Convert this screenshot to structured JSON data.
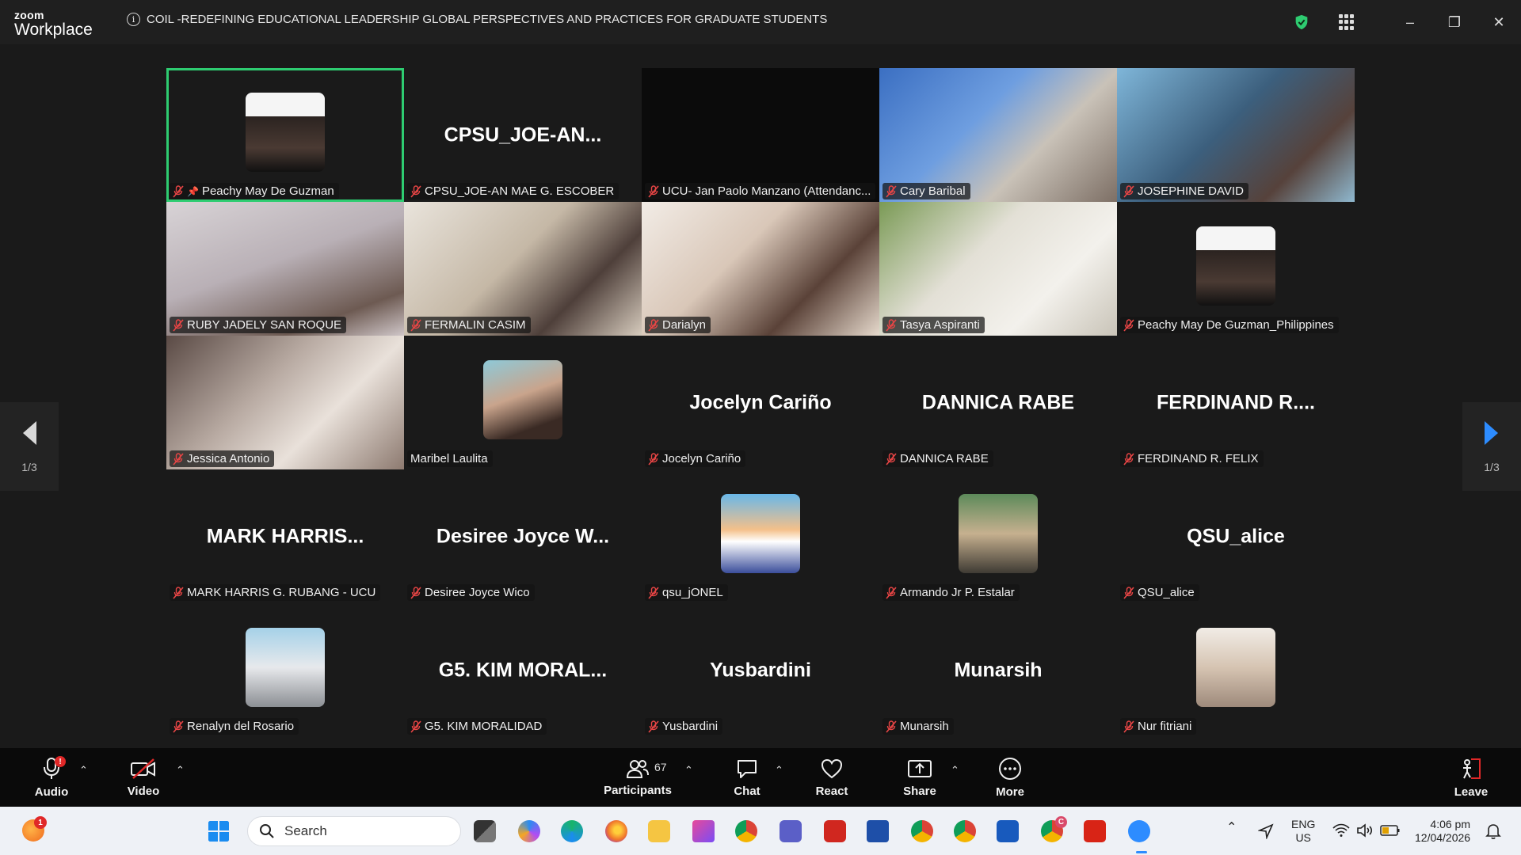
{
  "app": {
    "logo_top": "zoom",
    "logo_bottom": "Workplace",
    "meeting_title": "COIL -REDEFINING EDUCATIONAL LEADERSHIP GLOBAL PERSPECTIVES AND PRACTICES FOR GRADUATE STUDENTS",
    "security_color": "#2ecc71"
  },
  "window_controls": {
    "minimize": "–",
    "restore": "❐",
    "close": "✕"
  },
  "gallery": {
    "page_left": "1/3",
    "page_right": "1/3",
    "tiles": [
      {
        "label": "Peachy May De Guzman",
        "display": "photo",
        "pinned": true,
        "active": true
      },
      {
        "label": "CPSU_JOE-AN MAE G. ESCOBER",
        "display": "name",
        "big": "CPSU_JOE-AN..."
      },
      {
        "label": "UCU- Jan Paolo Manzano (Attendanc...",
        "display": "black"
      },
      {
        "label": "Cary Baribal",
        "display": "video"
      },
      {
        "label": "JOSEPHINE DAVID",
        "display": "video"
      },
      {
        "label": "RUBY JADELY SAN ROQUE",
        "display": "video"
      },
      {
        "label": "FERMALIN CASIM",
        "display": "video"
      },
      {
        "label": "Darialyn",
        "display": "video"
      },
      {
        "label": "Tasya Aspiranti",
        "display": "video"
      },
      {
        "label": "Peachy May De Guzman_Philippines",
        "display": "photo"
      },
      {
        "label": "Jessica Antonio",
        "display": "video"
      },
      {
        "label": "Maribel Laulita",
        "display": "photo",
        "unmuted": true
      },
      {
        "label": "Jocelyn Cariño",
        "display": "name",
        "big": "Jocelyn Cariño"
      },
      {
        "label": "DANNICA RABE",
        "display": "name",
        "big": "DANNICA RABE"
      },
      {
        "label": "FERDINAND R. FELIX",
        "display": "name",
        "big": "FERDINAND R...."
      },
      {
        "label": "MARK HARRIS G. RUBANG - UCU",
        "display": "name",
        "big": "MARK HARRIS..."
      },
      {
        "label": "Desiree Joyce Wico",
        "display": "name",
        "big": "Desiree Joyce W..."
      },
      {
        "label": "qsu_jONEL",
        "display": "photo"
      },
      {
        "label": "Armando Jr P. Estalar",
        "display": "photo"
      },
      {
        "label": "QSU_alice",
        "display": "name",
        "big": "QSU_alice"
      },
      {
        "label": "Renalyn del Rosario",
        "display": "photo"
      },
      {
        "label": "G5. KIM MORALIDAD",
        "display": "name",
        "big": "G5. KIM MORAL..."
      },
      {
        "label": "Yusbardini",
        "display": "name",
        "big": "Yusbardini"
      },
      {
        "label": "Munarsih",
        "display": "name",
        "big": "Munarsih"
      },
      {
        "label": "Nur fitriani",
        "display": "photo"
      }
    ]
  },
  "toolbar": {
    "audio": "Audio",
    "audio_badge": "!",
    "video": "Video",
    "participants": "Participants",
    "participants_count": "67",
    "chat": "Chat",
    "react": "React",
    "share": "Share",
    "more": "More",
    "leave": "Leave",
    "caret": "⌃"
  },
  "taskbar": {
    "search_placeholder": "Search",
    "notif_count": "1",
    "lang_1": "ENG",
    "lang_2": "US",
    "time": "4:06 pm",
    "date": "12/04/2026",
    "chrome_badge": "C"
  }
}
